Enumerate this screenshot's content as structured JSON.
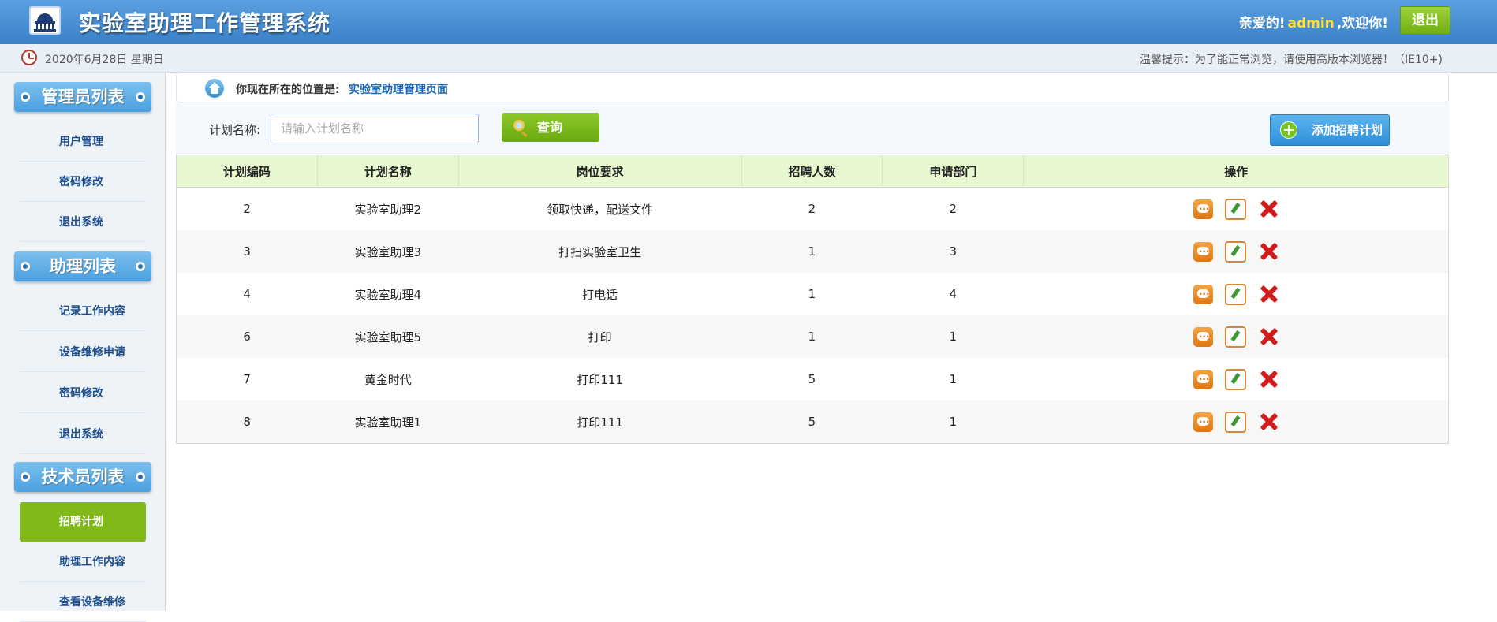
{
  "header": {
    "app_title": "实验室助理工作管理系统",
    "greeting_prefix": "亲爱的!",
    "username": "admin",
    "greeting_suffix": ",欢迎你!",
    "logout_label": "退出"
  },
  "infobar": {
    "date": "2020年6月28日 星期日",
    "tip": "温馨提示：为了能正常浏览，请使用高版本浏览器！（IE10+)"
  },
  "sidebar": {
    "groups": [
      {
        "title": "管理员列表",
        "items": [
          "用户管理",
          "密码修改",
          "退出系统"
        ]
      },
      {
        "title": "助理列表",
        "items": [
          "记录工作内容",
          "设备维修申请",
          "密码修改",
          "退出系统"
        ]
      },
      {
        "title": "技术员列表",
        "items": [
          "招聘计划",
          "助理工作内容",
          "查看设备维修"
        ]
      }
    ],
    "active_item": "招聘计划"
  },
  "breadcrumb": {
    "label": "你现在所在的位置是:",
    "current": "实验室助理管理页面"
  },
  "search": {
    "label": "计划名称:",
    "placeholder": "请输入计划名称",
    "value": "",
    "query_label": "查询",
    "add_label": "添加招聘计划"
  },
  "table": {
    "columns": [
      "计划编码",
      "计划名称",
      "岗位要求",
      "招聘人数",
      "申请部门",
      "操作"
    ],
    "rows": [
      [
        "2",
        "实验室助理2",
        "领取快递，配送文件",
        "2",
        "2"
      ],
      [
        "3",
        "实验室助理3",
        "打扫实验室卫生",
        "1",
        "3"
      ],
      [
        "4",
        "实验室助理4",
        "打电话",
        "1",
        "4"
      ],
      [
        "6",
        "实验室助理5",
        "打印",
        "1",
        "1"
      ],
      [
        "7",
        "黄金时代",
        "打印111",
        "5",
        "1"
      ],
      [
        "8",
        "实验室助理1",
        "打印111",
        "5",
        "1"
      ]
    ],
    "row_actions": [
      "message-icon",
      "edit-icon",
      "delete-icon"
    ]
  },
  "colors": {
    "header_blue": "#3a80c8",
    "accent_green": "#80b918",
    "table_header_bg": "#e7f7cf",
    "username_yellow": "#ffe033"
  }
}
